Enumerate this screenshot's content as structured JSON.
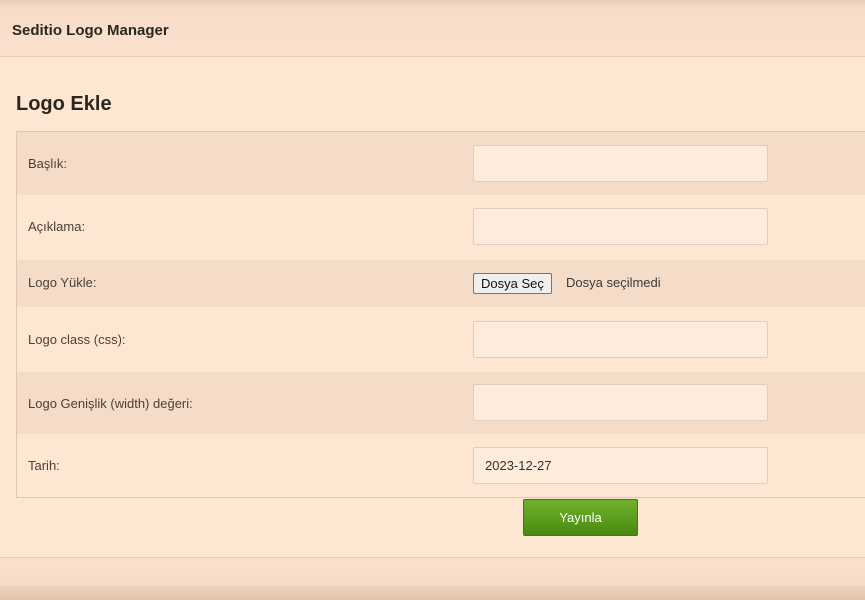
{
  "header": {
    "title": "Seditio Logo Manager"
  },
  "section": {
    "title": "Logo Ekle"
  },
  "form": {
    "rows": [
      {
        "label": "Başlık:",
        "value": ""
      },
      {
        "label": "Açıklama:",
        "value": ""
      },
      {
        "label": "Logo Yükle:",
        "button_label": "Dosya Seç",
        "status": "Dosya seçilmedi"
      },
      {
        "label": "Logo class (css):",
        "value": ""
      },
      {
        "label": "Logo Genişlik (width) değeri:",
        "value": ""
      },
      {
        "label": "Tarih:",
        "value": "2023-12-27"
      }
    ],
    "submit_label": "Yayınla"
  },
  "colors": {
    "background": "#fde6d2",
    "row_alt": "#f5dcc8",
    "button_green": "#5a9b1c"
  }
}
